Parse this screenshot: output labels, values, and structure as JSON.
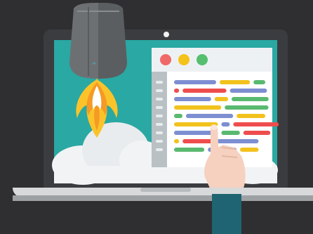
{
  "illustration": {
    "rocket": {
      "chevron_glyph": "^"
    },
    "colors": {
      "background": "#2f2f31",
      "laptop_bezel": "#3b3c3f",
      "screen": "#2aa8a3",
      "window_header": "#eef1f3",
      "line_gutter": "#b9c1c5",
      "traffic_red": "#f06969",
      "traffic_yellow": "#f4c21b",
      "traffic_green": "#55bf6f",
      "code_blue": "#7d8ed1",
      "code_yellow": "#f2c21d",
      "code_green": "#59b96f",
      "code_red": "#ef4d4d",
      "skin": "#f6d1bf",
      "sleeve": "#1f6472"
    },
    "code_lines": [
      {
        "segments": [
          {
            "color": "blue",
            "w": 0.25
          },
          {
            "color": "yellow",
            "w": 0.18
          },
          {
            "color": "green",
            "w": 0.07
          }
        ]
      },
      {
        "segments": [
          {
            "color": "red",
            "w": 0.03
          },
          {
            "color": "red",
            "w": 0.26
          },
          {
            "color": "blue",
            "w": 0.22
          }
        ]
      },
      {
        "segments": [
          {
            "color": "blue",
            "w": 0.22
          },
          {
            "color": "yellow",
            "w": 0.08
          },
          {
            "color": "green",
            "w": 0.22
          }
        ]
      },
      {
        "segments": [
          {
            "color": "yellow",
            "w": 0.28
          },
          {
            "color": "green",
            "w": 0.26
          }
        ]
      },
      {
        "segments": [
          {
            "color": "green",
            "w": 0.05
          },
          {
            "color": "blue",
            "w": 0.28
          },
          {
            "color": "yellow",
            "w": 0.17
          }
        ]
      },
      {
        "segments": [
          {
            "color": "yellow",
            "w": 0.26
          },
          {
            "color": "blue",
            "w": 0.05
          },
          {
            "color": "red",
            "w": 0.27
          }
        ]
      },
      {
        "segments": [
          {
            "color": "blue",
            "w": 0.26
          },
          {
            "color": "green",
            "w": 0.11
          },
          {
            "color": "red",
            "w": 0.16
          }
        ]
      },
      {
        "segments": [
          {
            "color": "yellow",
            "w": 0.03
          },
          {
            "color": "red",
            "w": 0.18
          },
          {
            "color": "blue",
            "w": 0.25
          }
        ]
      },
      {
        "segments": [
          {
            "color": "green",
            "w": 0.18
          },
          {
            "color": "blue",
            "w": 0.17
          },
          {
            "color": "yellow",
            "w": 0.11
          }
        ]
      }
    ]
  }
}
